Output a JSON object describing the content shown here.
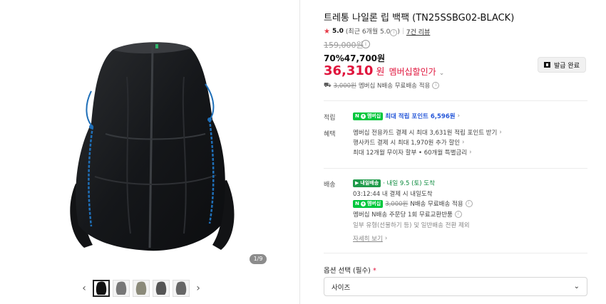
{
  "gallery": {
    "counter": "1/9",
    "prev_arrow": "‹",
    "next_arrow": "›"
  },
  "product": {
    "title": "트레통 나일론 립 백팩 (TN25SSBG02-BLACK)",
    "rating": {
      "star": "★",
      "score": "5.0",
      "recent": "(최근 6개월 5.0",
      "recent_close": ")",
      "sep": "|",
      "review_count": "7건 리뷰"
    },
    "original_price": "159,000원",
    "sale_price": "70%47,700원",
    "member_price": {
      "amount": "36,310",
      "unit": "원",
      "label": "멤버십할인가",
      "chevron": "⌄"
    },
    "coupon_button": "발급 완료",
    "shipping_note": {
      "strike": "3,000원",
      "text": "멤버십 N배송 무료배송 적용"
    }
  },
  "benefits": {
    "points": {
      "label": "적립",
      "badge": "멤버십",
      "text": "최대 적립 포인트",
      "value": "6,596원",
      "chevron": "›"
    },
    "perks": {
      "label": "혜택",
      "lines": [
        {
          "text": "멤버십 전용카드 결제 시 최대 3,631원 적립 포인트 받기",
          "chevron": "›"
        },
        {
          "text": "행사카드 결제 시 최대 1,970원 추가 할인",
          "chevron": "›"
        },
        {
          "text": "최대 12개월 무이자 할부 • 60개월 특별금리",
          "chevron": "›"
        }
      ]
    }
  },
  "delivery": {
    "label": "배송",
    "badge": "내일배송",
    "eta": "· 내일 9.5 (토) 도착",
    "cutoff": "03:12:44  내 결제 시 내일도착",
    "shipping_badge": "멤버십",
    "shipping_strike": "3,000원",
    "shipping_text": "N배송 무료배송 적용",
    "exchange": "멤버십 N배송 주문당 1회 무료교환반품",
    "exclude": "일부 유형(선물하기 등) 및 일반배송 전환 제외",
    "more": "자세히 보기",
    "more_chevron": "›"
  },
  "options": {
    "label": "옵션 선택 (필수)",
    "required_mark": "*",
    "select_value": "사이즈",
    "select_chevron": "⌄"
  },
  "colors": {
    "accent_red": "#e0143c",
    "naver_green": "#00c73c",
    "point_blue": "#2456d8"
  }
}
